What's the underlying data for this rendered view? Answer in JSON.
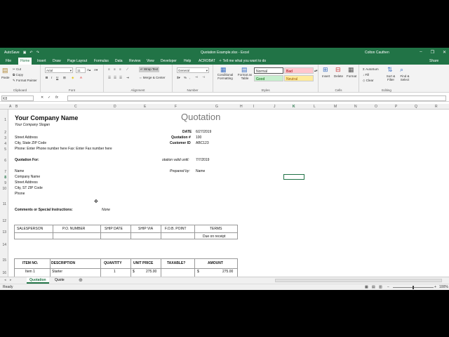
{
  "titlebar": {
    "quick_access": "AutoSave",
    "title": "Quotation Example.xlsx - Excel",
    "user": "Colton Cauthen"
  },
  "tabs": [
    "File",
    "Home",
    "Insert",
    "Draw",
    "Page Layout",
    "Formulas",
    "Data",
    "Review",
    "View",
    "Developer",
    "Help",
    "ACROBAT"
  ],
  "tell_me": "Tell me what you want to do",
  "share": "Share",
  "ribbon": {
    "clipboard": {
      "label": "Clipboard",
      "paste": "Paste",
      "cut": "Cut",
      "copy": "Copy",
      "format_painter": "Format Painter"
    },
    "font": {
      "label": "Font",
      "name": "Arial",
      "size": "11"
    },
    "alignment": {
      "label": "Alignment",
      "wrap": "Wrap Text",
      "merge": "Merge & Center"
    },
    "number": {
      "label": "Number",
      "format": "General"
    },
    "styles": {
      "label": "Styles",
      "conditional": "Conditional Formatting",
      "format_table": "Format as Table",
      "normal": "Normal",
      "bad": "Bad",
      "good": "Good",
      "neutral": "Neutral"
    },
    "cells": {
      "label": "Cells",
      "insert": "Insert",
      "delete": "Delete",
      "format": "Format"
    },
    "editing": {
      "label": "Editing",
      "autosum": "AutoSum",
      "fill": "Fill",
      "clear": "Clear",
      "sort": "Sort & Filter",
      "find": "Find & Select"
    }
  },
  "formula_bar": {
    "name_box": "K8",
    "fx": "fx",
    "value": ""
  },
  "columns": [
    "A",
    "B",
    "C",
    "D",
    "E",
    "F",
    "G",
    "H",
    "I",
    "J",
    "K",
    "L",
    "M",
    "N",
    "O",
    "P",
    "Q",
    "R"
  ],
  "rows": [
    "1",
    "2",
    "3",
    "4",
    "5",
    "6",
    "7",
    "8",
    "9",
    "10",
    "11",
    "12",
    "13",
    "14",
    "15",
    "16"
  ],
  "sheet": {
    "company": "Your Company Name",
    "slogan": "Your Company Slogan",
    "heading": "Quotation",
    "street": "Street Address",
    "city": "City, State ZIP Code",
    "phone": "Phone: Enter Phone number here   Fax: Enter Fax number here",
    "date_label": "DATE",
    "date_value": "6/27/2019",
    "quote_label": "Quotation #",
    "quote_value": "100",
    "cust_label": "Customer ID",
    "cust_value": "ABC123",
    "quote_for": "Quotation For:",
    "valid_label": "otation valid until:",
    "valid_value": "7/7/2019",
    "name": "Name",
    "comp_name": "Company Name",
    "addr": "Street Address",
    "cityst": "City, ST  ZIP Code",
    "ph": "Phone",
    "prep_label": "Prepared by:",
    "prep_value": "Name",
    "comments_label": "Comments or Special Instructions:",
    "comments_value": "None",
    "ship_headers": [
      "SALESPERSON",
      "P.O. NUMBER",
      "SHIP DATE",
      "SHIP VIA",
      "F.O.B. POINT",
      "TERMS"
    ],
    "terms_value": "Due on receipt",
    "item_headers": [
      "ITEM NO.",
      "DESCRIPTION",
      "QUANTITY",
      "UNIT PRICE",
      "TAXABLE?",
      "AMOUNT"
    ],
    "item_row": {
      "no": "Item 1",
      "desc": "Starter",
      "qty": "1",
      "cur": "$",
      "price": "275.00",
      "cur2": "$",
      "amount": "275.00"
    }
  },
  "sheet_tabs": [
    "Quotation",
    "Quote"
  ],
  "status": {
    "ready": "Ready",
    "zoom": "100%"
  }
}
